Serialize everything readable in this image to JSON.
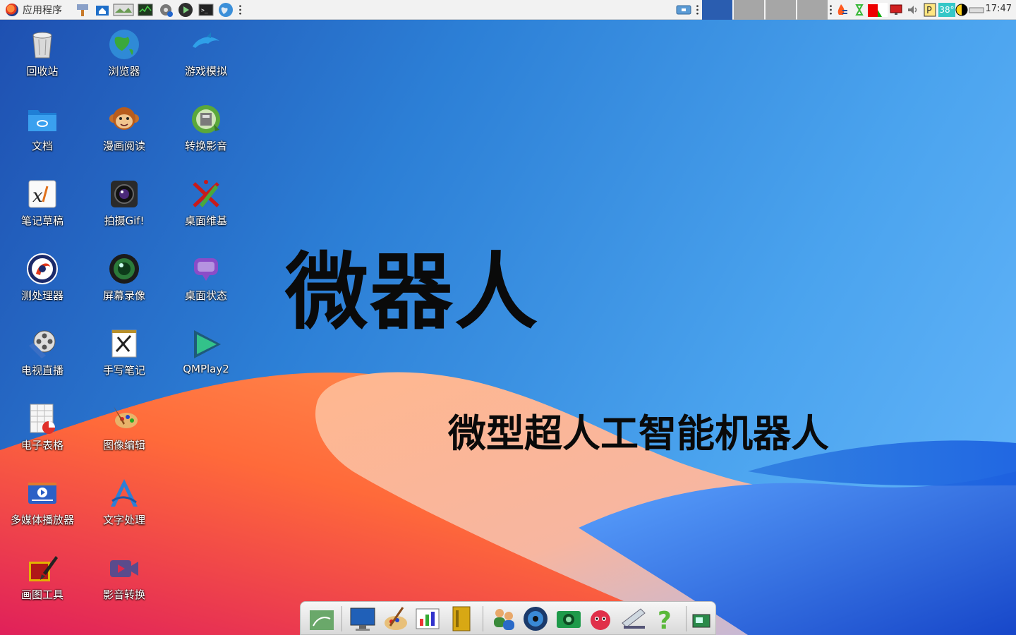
{
  "top_panel": {
    "app_menu_label": "应用程序",
    "clock": "17:47",
    "temperature": "38°",
    "launchers": [
      "eraser-tool-icon",
      "home-folder-icon",
      "image-viewer-icon",
      "system-monitor-icon",
      "network-tool-icon",
      "media-player-icon",
      "terminal-icon",
      "globe-icon"
    ],
    "workspaces": 4,
    "active_workspace": 1
  },
  "desktop": {
    "title": "微器人",
    "subtitle": "微型超人工智能机器人",
    "icons": [
      {
        "label": "回收站",
        "icon": "trash-icon"
      },
      {
        "label": "浏览器",
        "icon": "globe-icon"
      },
      {
        "label": "游戏模拟",
        "icon": "dolphin-icon"
      },
      {
        "label": "文档",
        "icon": "folder-icon"
      },
      {
        "label": "漫画阅读",
        "icon": "monkey-icon"
      },
      {
        "label": "转换影音",
        "icon": "converter-icon"
      },
      {
        "label": "笔记草稿",
        "icon": "xournal-icon"
      },
      {
        "label": "拍摄Gif!",
        "icon": "camera-icon"
      },
      {
        "label": "桌面维基",
        "icon": "tools-icon"
      },
      {
        "label": "测处理器",
        "icon": "cpu-tester-icon"
      },
      {
        "label": "屏幕录像",
        "icon": "lens-icon"
      },
      {
        "label": "桌面状态",
        "icon": "monitor-status-icon"
      },
      {
        "label": "电视直播",
        "icon": "film-reel-icon"
      },
      {
        "label": "手写笔记",
        "icon": "pen-note-icon"
      },
      {
        "label": "QMPlay2",
        "icon": "play-triangle-icon"
      },
      {
        "label": "电子表格",
        "icon": "spreadsheet-icon"
      },
      {
        "label": "图像编辑",
        "icon": "palette-icon"
      },
      {
        "label": "多媒体播放器",
        "icon": "video-player-icon"
      },
      {
        "label": "文字处理",
        "icon": "word-processor-icon"
      },
      {
        "label": "画图工具",
        "icon": "paint-icon"
      },
      {
        "label": "影音转换",
        "icon": "video-camera-icon"
      }
    ]
  },
  "dock": {
    "items": [
      "file-manager-icon",
      "monitor-icon",
      "paint-brush-icon",
      "chart-icon",
      "notebook-icon",
      "users-icon",
      "disc-icon",
      "photo-camera-icon",
      "mascot-icon",
      "scanner-icon",
      "help-icon",
      "screenshot-icon"
    ]
  },
  "colors": {
    "panel_bg": "#f2f2f2",
    "workspace_active": "#2a5db0",
    "workspace_inactive": "#a6a6a6",
    "title_color": "#0a0a0a"
  }
}
